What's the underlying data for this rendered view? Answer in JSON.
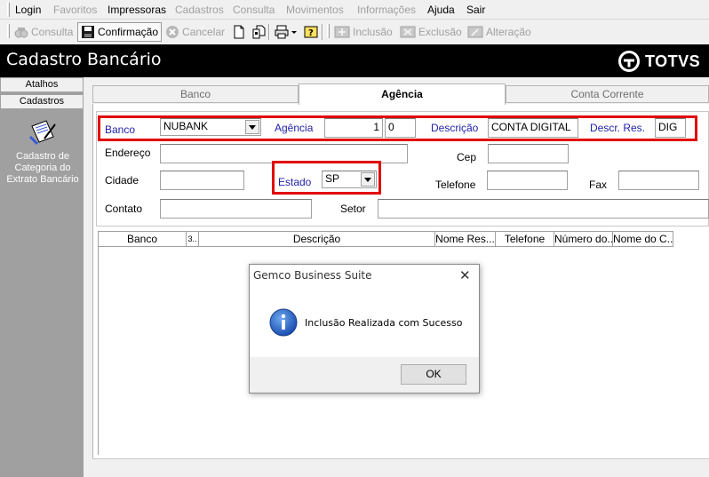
{
  "menu": {
    "items": [
      {
        "label": "Login",
        "enabled": true
      },
      {
        "label": "Favoritos",
        "enabled": false
      },
      {
        "label": "Impressoras",
        "enabled": true
      },
      {
        "label": "Cadastros",
        "enabled": false
      },
      {
        "label": "Consulta",
        "enabled": false
      },
      {
        "label": "Movimentos",
        "enabled": false
      },
      {
        "label": "Informações",
        "enabled": false
      },
      {
        "label": "Ajuda",
        "enabled": true
      },
      {
        "label": "Sair",
        "enabled": true
      }
    ]
  },
  "toolbar": {
    "consulta": "Consulta",
    "confirmacao": "Confirmação",
    "cancelar": "Cancelar",
    "inclusao": "Inclusão",
    "exclusao": "Exclusão",
    "alteracao": "Alteração"
  },
  "header": {
    "title": "Cadastro Bancário",
    "brand": "TOTVS"
  },
  "sidebar": {
    "tabs": [
      "Atalhos",
      "Cadastros"
    ],
    "item_label": "Cadastro de Categoria do Extrato Bancário"
  },
  "tabs": {
    "banco": "Banco",
    "agencia": "Agência",
    "conta_corrente": "Conta Corrente"
  },
  "form": {
    "banco_label": "Banco",
    "banco_value": "NUBANK",
    "agencia_label": "Agência",
    "agencia_value": "1",
    "agencia_digit": "0",
    "descricao_label": "Descrição",
    "descricao_value": "CONTA DIGITAL",
    "descr_res_label": "Descr. Res.",
    "descr_res_value": "DIG",
    "endereco_label": "Endereço",
    "endereco_value": "",
    "cep_label": "Cep",
    "cep_value": "",
    "cidade_label": "Cidade",
    "cidade_value": "",
    "estado_label": "Estado",
    "estado_value": "SP",
    "telefone_label": "Telefone",
    "telefone_value": "",
    "fax_label": "Fax",
    "fax_value": "",
    "contato_label": "Contato",
    "contato_value": "",
    "setor_label": "Setor",
    "setor_value": ""
  },
  "grid": {
    "columns": [
      "Banco",
      "3..",
      "Descrição",
      "Nome Res...",
      "Telefone",
      "Número do...",
      "Nome do C..."
    ]
  },
  "dialog": {
    "title": "Gemco Business Suite",
    "message": "Inclusão Realizada com Sucesso",
    "ok_label": "OK"
  },
  "colors": {
    "highlight": "#e10000",
    "label_blue": "#1f1fa8",
    "header_bg": "#000000",
    "sidebar_bg": "#a0a0a0"
  }
}
